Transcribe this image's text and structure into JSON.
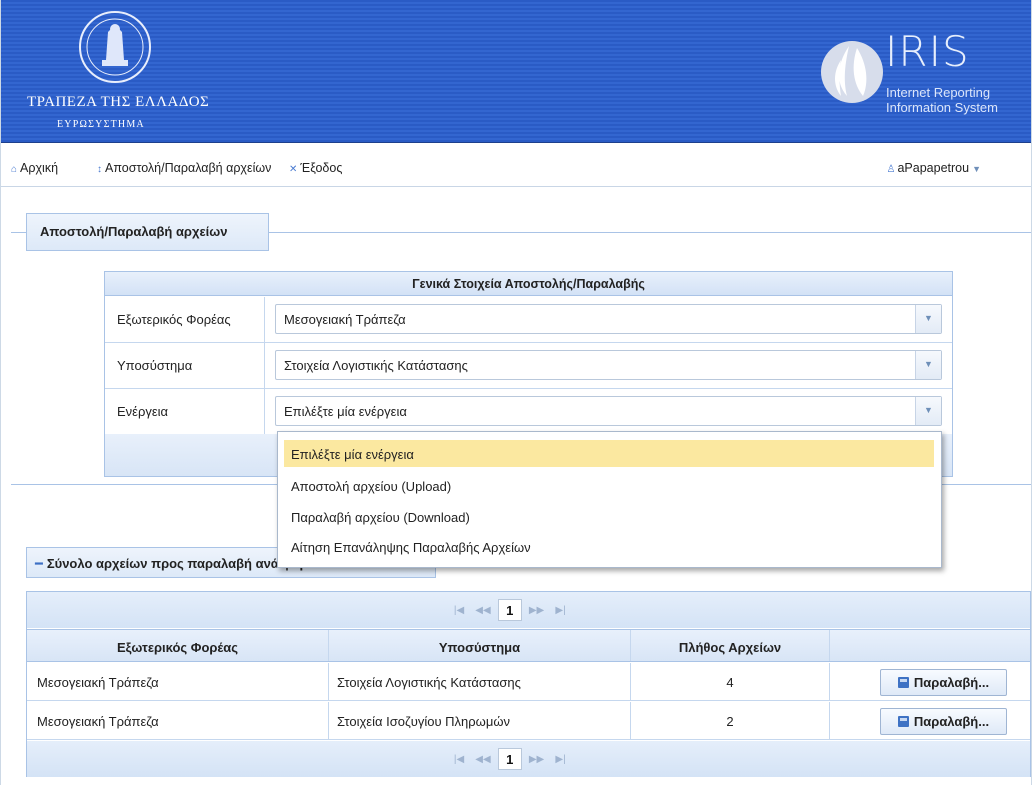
{
  "header": {
    "bank_name": "ΤΡΑΠΕΖΑ ΤΗΣ ΕΛΛΑΔΟΣ",
    "bank_sub": "ΕΥΡΩΣΥΣΤΗΜΑ",
    "iris_title": "IRIS",
    "iris_sub_1": "Internet Reporting",
    "iris_sub_2": "Information System"
  },
  "nav": {
    "home": "Αρχική",
    "transfer": "Αποστολή/Παραλαβή αρχείων",
    "logout": "Έξοδος",
    "user": "aPapapetrou"
  },
  "section": {
    "title": "Αποστολή/Παραλαβή αρχείων"
  },
  "form": {
    "heading": "Γενικά Στοιχεία Αποστολής/Παραλαβής",
    "rows": [
      {
        "label": "Εξωτερικός Φορέας",
        "value": "Μεσογειακή Τράπεζα"
      },
      {
        "label": "Υποσύστημα",
        "value": "Στοιχεία Λογιστικής Κατάστασης"
      },
      {
        "label": "Ενέργεια",
        "value": "Επιλέξτε μία ενέργεια"
      }
    ]
  },
  "dropdown": {
    "options": [
      "Επιλέξτε μία ενέργεια",
      "Αποστολή αρχείου (Upload)",
      "Παραλαβή αρχείου (Download)",
      "Αίτηση Επανάληψης Παραλαβής Αρχείων"
    ],
    "selected_index": 0
  },
  "files": {
    "title": "Σύνολο αρχείων προς παραλαβή ανά φορέα",
    "page": "1",
    "columns": [
      "Εξωτερικός Φορέας",
      "Υποσύστημα",
      "Πλήθος Αρχείων",
      ""
    ],
    "rows": [
      {
        "entity": "Μεσογειακή Τράπεζα",
        "subsystem": "Στοιχεία Λογιστικής Κατάστασης",
        "count": "4",
        "action": "Παραλαβή..."
      },
      {
        "entity": "Μεσογειακή Τράπεζα",
        "subsystem": "Στοιχεία Ισοζυγίου Πληρωμών",
        "count": "2",
        "action": "Παραλαβή..."
      }
    ]
  },
  "colors": {
    "banner": "#3366d0",
    "accent": "#4a7bd1",
    "highlight": "#fbe8a0"
  }
}
